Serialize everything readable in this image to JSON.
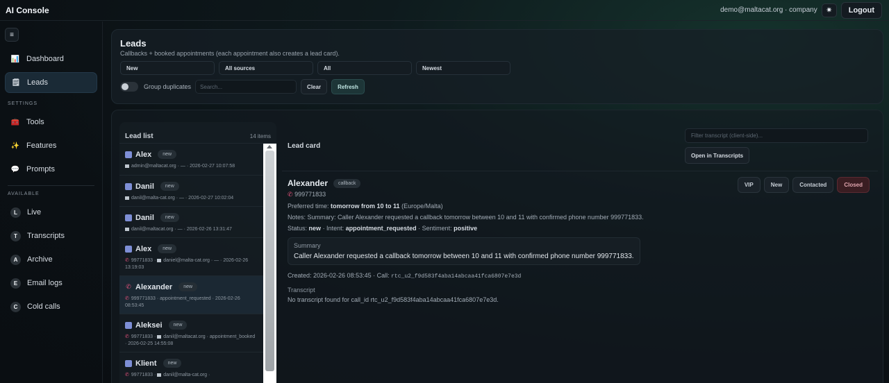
{
  "app": {
    "title": "AI Console"
  },
  "header": {
    "user": "demo@maltacat.org · company",
    "theme_icon": "✷",
    "logout": "Logout"
  },
  "sidebar": {
    "menu_icon": "≡",
    "main": [
      {
        "label": "Dashboard",
        "icon": "📊"
      },
      {
        "label": "Leads",
        "icon": "🗒"
      }
    ],
    "settings_label": "SETTINGS",
    "settings": [
      {
        "label": "Tools",
        "icon": "🧰"
      },
      {
        "label": "Features",
        "icon": "✨"
      },
      {
        "label": "Prompts",
        "icon": "💬"
      }
    ],
    "available_label": "AVAILABLE",
    "available": [
      {
        "label": "Live",
        "letter": "L"
      },
      {
        "label": "Transcripts",
        "letter": "T"
      },
      {
        "label": "Archive",
        "letter": "A"
      },
      {
        "label": "Email logs",
        "letter": "E"
      },
      {
        "label": "Cold calls",
        "letter": "C"
      }
    ]
  },
  "leads_header": {
    "title": "Leads",
    "subtitle": "Callbacks + booked appointments (each appointment also creates a lead card).",
    "filters": [
      "New",
      "All sources",
      "All",
      "Newest"
    ],
    "group_duplicates": "Group duplicates",
    "search_placeholder": "Search...",
    "clear": "Clear",
    "refresh": "Refresh"
  },
  "lead_list": {
    "title": "Lead list",
    "count": "14 items",
    "items": [
      {
        "name": "Alex",
        "badge": "new",
        "meta": "admin@maltacat.org · — · 2026-02-27 10:07:58",
        "type": "mail"
      },
      {
        "name": "Danil",
        "badge": "new",
        "meta": "danil@malta-cat.org · — · 2026-02-27 10:02:04",
        "type": "mail"
      },
      {
        "name": "Danil",
        "badge": "new",
        "meta": "danil@maltacat.org · — · 2026-02-26 13:31:47",
        "type": "mail"
      },
      {
        "name": "Alex",
        "badge": "new",
        "meta_phone": "99771833 ·",
        "meta": "daniel@malta-cat.org · — · 2026-02-26 13:19:03",
        "type": "mail"
      },
      {
        "name": "Alexander",
        "badge": "new",
        "meta_phone": "999771833 · appointment_requested · 2026-02-26 08:53:45",
        "meta": "",
        "type": "phone"
      },
      {
        "name": "Aleksei",
        "badge": "new",
        "meta_phone": "99771833 ·",
        "meta": "danil@maltacat.org · appointment_booked · 2026-02-25 14:55:08",
        "type": "mail"
      },
      {
        "name": "Klient",
        "badge": "new",
        "meta_phone": "99771833 ·",
        "meta": "danil@malta-cat.org ·",
        "type": "mail"
      }
    ]
  },
  "lead_card": {
    "title": "Lead card",
    "filter_placeholder": "Filter transcript (client-side)...",
    "open_transcripts": "Open in Transcripts",
    "name": "Alexander",
    "source_badge": "callback",
    "status_buttons": [
      "VIP",
      "New",
      "Contacted",
      "Closed"
    ],
    "phone": "999771833",
    "preferred_label": "Preferred time:",
    "preferred_value": "tomorrow from 10 to 11",
    "preferred_tz": "(Europe/Malta)",
    "notes": "Notes: Summary: Caller Alexander requested a callback tomorrow between 10 and 11 with confirmed phone number 999771833.",
    "status_label": "Status:",
    "status_value": "new",
    "intent_label": "· Intent:",
    "intent_value": "appointment_requested",
    "sentiment_label": "· Sentiment:",
    "sentiment_value": "positive",
    "summary_label": "Summary",
    "summary_text": "Caller Alexander requested a callback tomorrow between 10 and 11 with confirmed phone number 999771833.",
    "created_text": "Created: 2026-02-26 08:53:45 · Call:",
    "call_id": "rtc_u2_f9d583f4aba14abcaa41fca6807e7e3d",
    "transcript_label": "Transcript",
    "transcript_text": "No transcript found for call_id rtc_u2_f9d583f4aba14abcaa41fca6807e7e3d."
  }
}
